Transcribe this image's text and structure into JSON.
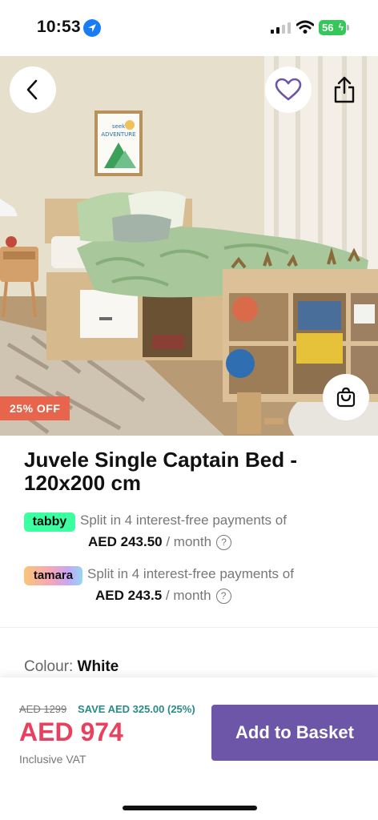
{
  "status_bar": {
    "time": "10:53",
    "battery": "56"
  },
  "product": {
    "title": "Juvele Single Captain Bed - 120x200 cm",
    "discount_badge": "25% OFF",
    "colour_label": "Colour:",
    "colour_value": "White"
  },
  "installments": [
    {
      "provider": "tabby",
      "logo_text": "tabby",
      "text": "Split in 4 interest-free payments of",
      "amount": "AED 243.50",
      "period": " / month",
      "help": "?"
    },
    {
      "provider": "tamara",
      "logo_text": "tamara",
      "text": "Split in 4 interest-free payments of",
      "amount": "AED 243.5",
      "period": " / month",
      "help": "?"
    }
  ],
  "price_bar": {
    "old_price": "AED 1299",
    "save_text": "SAVE AED 325.00 (25%)",
    "price": "AED 974",
    "vat_note": "Inclusive VAT",
    "add_button": "Add to Basket"
  },
  "poster_text": "seek ADVENTURE",
  "colors": {
    "accent": "#6d55a7",
    "price": "#e8415d",
    "save": "#2a8a8a",
    "badge": "#e8654d"
  },
  "icons": [
    "location-arrow-icon",
    "signal-icon",
    "wifi-icon",
    "battery-icon",
    "back-arrow-icon",
    "heart-icon",
    "share-icon",
    "shopping-bag-icon",
    "help-icon"
  ]
}
